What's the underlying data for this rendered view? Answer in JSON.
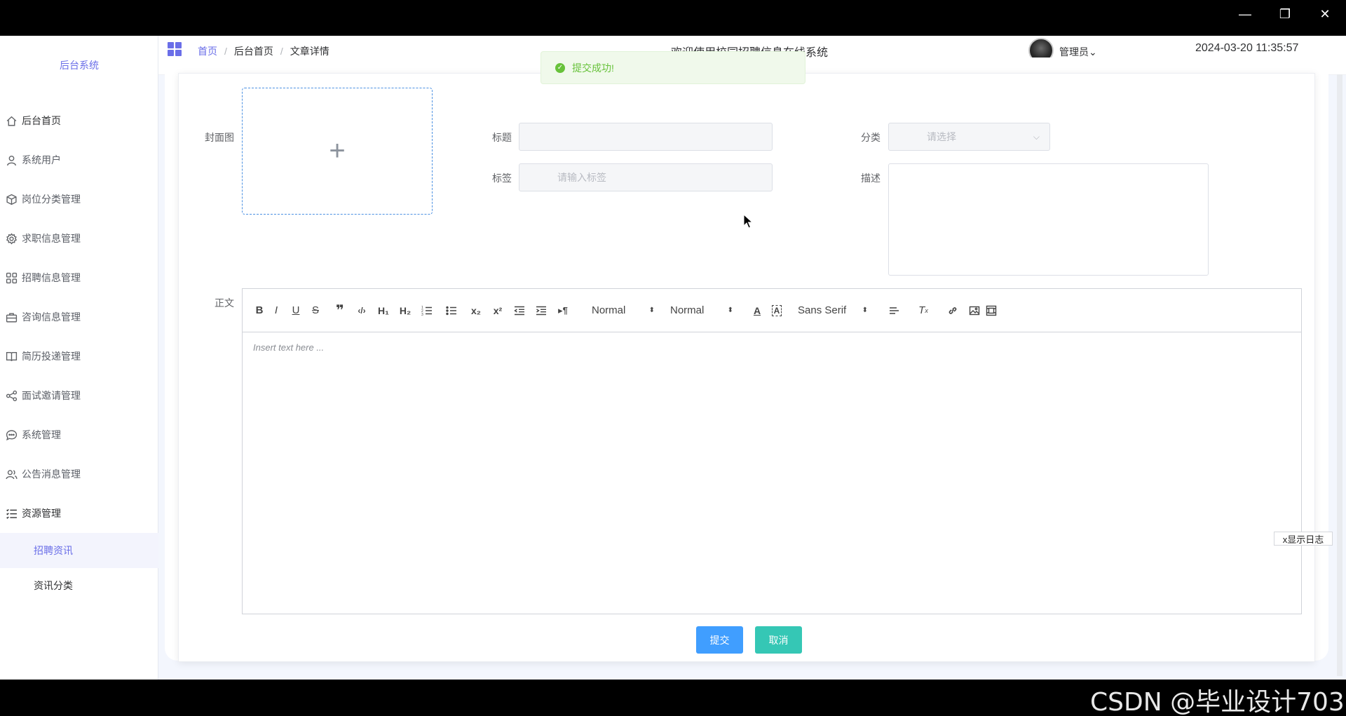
{
  "window": {
    "minimize": "—",
    "restore": "❐",
    "close": "✕"
  },
  "sidebar": {
    "brand": "后台系统",
    "items": [
      {
        "label": "后台首页",
        "icon": "home-icon"
      },
      {
        "label": "系统用户",
        "icon": "user-icon"
      },
      {
        "label": "岗位分类管理",
        "icon": "cube-icon"
      },
      {
        "label": "求职信息管理",
        "icon": "gear-icon"
      },
      {
        "label": "招聘信息管理",
        "icon": "grid-icon"
      },
      {
        "label": "咨询信息管理",
        "icon": "briefcase-icon"
      },
      {
        "label": "简历投递管理",
        "icon": "book-icon"
      },
      {
        "label": "面试邀请管理",
        "icon": "share-icon"
      },
      {
        "label": "系统管理",
        "icon": "chat-icon"
      },
      {
        "label": "公告消息管理",
        "icon": "users-icon"
      },
      {
        "label": "资源管理",
        "icon": "list-icon"
      }
    ],
    "sub_items": [
      {
        "label": "招聘资讯",
        "active": true
      },
      {
        "label": "资讯分类",
        "active": false
      }
    ]
  },
  "header": {
    "breadcrumb": [
      "首页",
      "后台首页",
      "文章详情"
    ],
    "welcome": "欢迎使用校园招聘信息在线系统",
    "user": "管理员",
    "datetime": "2024-03-20 11:35:57"
  },
  "toast": {
    "message": "提交成功!"
  },
  "form": {
    "cover_label": "封面图",
    "title_label": "标题",
    "title_value": "",
    "category_label": "分类",
    "category_placeholder": "请选择",
    "tags_label": "标签",
    "tags_placeholder": "请输入标签",
    "desc_label": "描述",
    "body_label": "正文",
    "editor_placeholder": "Insert text here ...",
    "header_select": "Normal",
    "size_select": "Normal",
    "font_select": "Sans Serif",
    "submit": "提交",
    "cancel": "取消"
  },
  "log_toggle": "x显示日志",
  "watermark": "CSDN @毕业设计703",
  "colors": {
    "accent": "#6a6ee8",
    "primary": "#409eff",
    "success": "#67c23a",
    "teal": "#35c7b5"
  }
}
